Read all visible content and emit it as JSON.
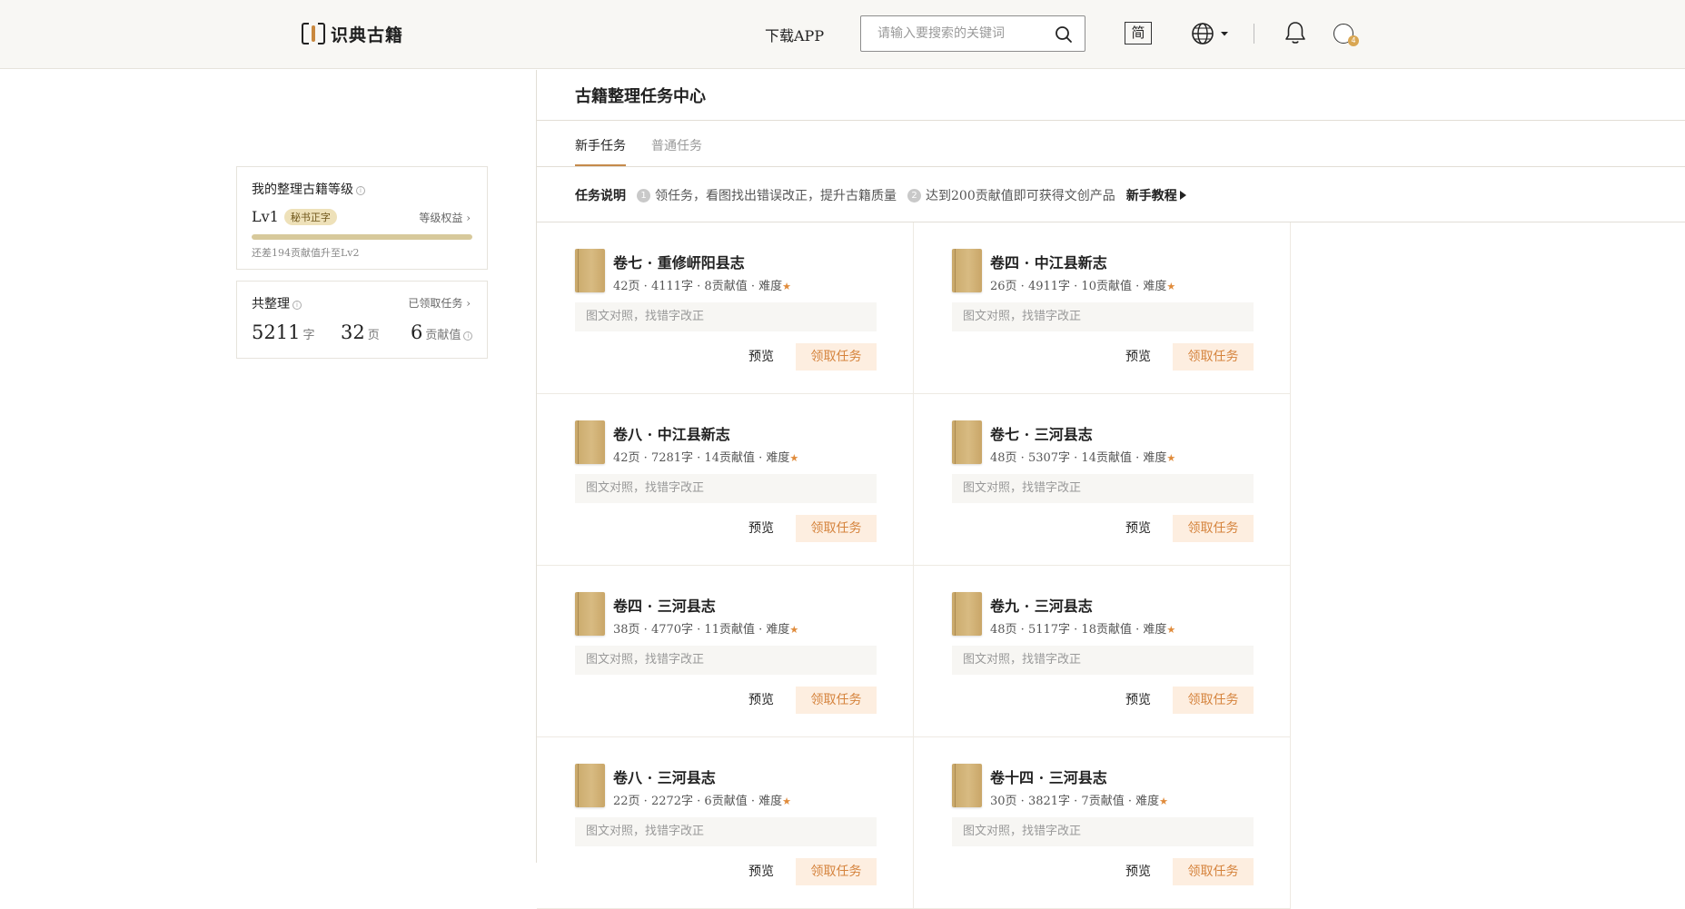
{
  "header": {
    "logo_text": "识典古籍",
    "download_app": "下载APP",
    "search_placeholder": "请输入要搜索的关键词",
    "simplified_label": "简",
    "avatar_badge": "4"
  },
  "level_card": {
    "title": "我的整理古籍等级",
    "level": "Lv1",
    "rank_badge": "秘书正字",
    "rights_link": "等级权益 ›",
    "progress_fraction": 1.0,
    "hint": "还差194贡献值升至Lv2"
  },
  "total_card": {
    "title": "共整理",
    "claimed_link": "已领取任务 ›",
    "chars_value": "5211",
    "chars_unit": "字",
    "pages_value": "32",
    "pages_unit": "页",
    "contrib_value": "6",
    "contrib_unit": "贡献值"
  },
  "main": {
    "title": "古籍整理任务中心",
    "tabs": [
      {
        "label": "新手任务"
      },
      {
        "label": "普通任务"
      }
    ],
    "explain": {
      "label": "任务说明",
      "step1_num": "1",
      "step1": "领任务，看图找出错误改正，提升古籍质量",
      "step2_num": "2",
      "step2": "达到200贡献值即可获得文创产品",
      "tutorial": "新手教程"
    }
  },
  "task_common": {
    "desc": "图文对照，找错字改正",
    "preview": "预览",
    "claim": "领取任务",
    "star": "★"
  },
  "tasks": [
    {
      "title": "卷七 · 重修岍阳县志",
      "meta": "42页 · 4111字 · 8贡献值 · 难度"
    },
    {
      "title": "卷四 · 中江县新志",
      "meta": "26页 · 4911字 · 10贡献值 · 难度"
    },
    {
      "title": "卷八 · 中江县新志",
      "meta": "42页 · 7281字 · 14贡献值 · 难度"
    },
    {
      "title": "卷七 · 三河县志",
      "meta": "48页 · 5307字 · 14贡献值 · 难度"
    },
    {
      "title": "卷四 · 三河县志",
      "meta": "38页 · 4770字 · 11贡献值 · 难度"
    },
    {
      "title": "卷九 · 三河县志",
      "meta": "48页 · 5117字 · 18贡献值 · 难度"
    },
    {
      "title": "卷八 · 三河县志",
      "meta": "22页 · 2272字 · 6贡献值 · 难度"
    },
    {
      "title": "卷十四 · 三河县志",
      "meta": "30页 · 3821字 · 7贡献值 · 难度"
    }
  ]
}
